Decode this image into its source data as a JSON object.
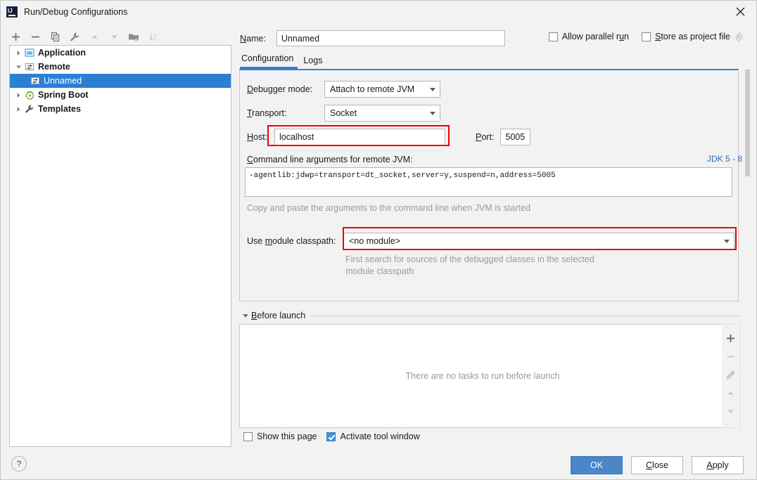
{
  "window": {
    "title": "Run/Debug Configurations",
    "logo_icon": "intellij-idea-logo",
    "close_icon": "close-icon"
  },
  "left_panel": {
    "toolbar": [
      {
        "name": "add-configuration-button",
        "icon": "plus-icon",
        "enabled": true
      },
      {
        "name": "remove-configuration-button",
        "icon": "minus-icon",
        "enabled": true
      },
      {
        "name": "copy-configuration-button",
        "icon": "copy-icon",
        "enabled": true
      },
      {
        "name": "edit-templates-button",
        "icon": "wrench-icon",
        "enabled": true
      },
      {
        "name": "move-up-button",
        "icon": "arrow-up-icon",
        "enabled": false
      },
      {
        "name": "move-down-button",
        "icon": "arrow-down-icon",
        "enabled": false
      },
      {
        "name": "create-folder-button",
        "icon": "folder-add-icon",
        "enabled": true
      },
      {
        "name": "sort-configurations-button",
        "icon": "sort-alphabetical-icon",
        "enabled": false
      }
    ],
    "tree": [
      {
        "label": "Application",
        "icon": "application-icon",
        "expanded": false,
        "selected": false,
        "child": false,
        "twisty": "right"
      },
      {
        "label": "Remote",
        "icon": "remote-icon",
        "expanded": true,
        "selected": false,
        "child": false,
        "twisty": "down"
      },
      {
        "label": "Unnamed",
        "icon": "remote-icon",
        "expanded": false,
        "selected": true,
        "child": true,
        "twisty": "none"
      },
      {
        "label": "Spring Boot",
        "icon": "spring-boot-icon",
        "expanded": false,
        "selected": false,
        "child": false,
        "twisty": "right"
      },
      {
        "label": "Templates",
        "icon": "wrench-icon",
        "expanded": false,
        "selected": false,
        "child": false,
        "twisty": "right"
      }
    ],
    "help_button_label": "?"
  },
  "right_panel": {
    "name_label": "Name:",
    "name_value": "Unnamed",
    "allow_parallel_run": {
      "label": "Allow parallel run",
      "checked": false
    },
    "store_as_project_file": {
      "label": "Store as project file",
      "checked": false,
      "gear_icon": "gear-icon"
    },
    "tabs": [
      {
        "label": "Configuration",
        "active": true
      },
      {
        "label": "Logs",
        "active": false
      }
    ],
    "form": {
      "debugger_mode_label": "Debugger mode:",
      "debugger_mode_value": "Attach to remote JVM",
      "transport_label": "Transport:",
      "transport_value": "Socket",
      "host_label": "Host:",
      "host_value": "localhost",
      "port_label": "Port:",
      "port_value": "5005",
      "cmdline_label": "Command line arguments for remote JVM:",
      "jdk_selector": "JDK 5 - 8",
      "cmdline_value": "-agentlib:jdwp=transport=dt_socket,server=y,suspend=n,address=5005",
      "cmdline_hint": "Copy and paste the arguments to the command line when JVM is started",
      "module_classpath_label": "Use module classpath:",
      "module_classpath_value": "<no module>",
      "module_hint_line1": "First search for sources of the debugged classes in the selected",
      "module_hint_line2": "module classpath"
    },
    "before_launch": {
      "title": "Before launch",
      "expanded": true,
      "empty_text": "There are no tasks to run before launch",
      "tools": [
        {
          "name": "add-task-button",
          "icon": "plus-icon",
          "enabled": true
        },
        {
          "name": "remove-task-button",
          "icon": "minus-icon",
          "enabled": false
        },
        {
          "name": "edit-task-button",
          "icon": "pencil-icon",
          "enabled": false
        },
        {
          "name": "move-task-up-button",
          "icon": "arrow-up-icon",
          "enabled": false
        },
        {
          "name": "move-task-down-button",
          "icon": "arrow-down-icon",
          "enabled": false
        }
      ]
    },
    "show_this_page": {
      "label": "Show this page",
      "checked": false
    },
    "activate_tool_window": {
      "label": "Activate tool window",
      "checked": true
    }
  },
  "footer": {
    "ok_label": "OK",
    "close_label": "Close",
    "apply_label": "Apply"
  },
  "colors": {
    "accent_blue": "#2b7fd4",
    "tab_underline": "#3d7eca",
    "highlight_red": "#ee0000",
    "primary_button": "#4a86c8",
    "link_blue": "#2f6cb5",
    "dialog_bg": "#f2f2f2"
  },
  "annotations": [
    {
      "name": "host-field-highlight",
      "target": "host-input",
      "color": "#ee0000"
    },
    {
      "name": "module-classpath-highlight",
      "target": "module-classpath-combo",
      "color": "#ee0000"
    }
  ]
}
